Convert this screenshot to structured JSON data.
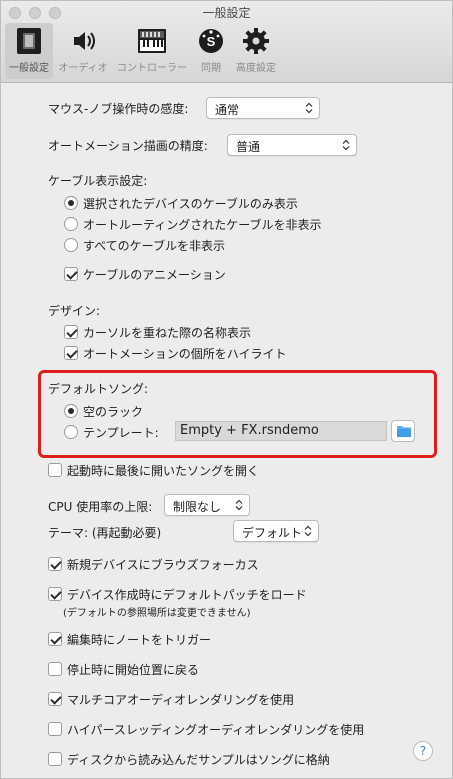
{
  "window": {
    "title": "一般設定"
  },
  "toolbar": {
    "tabs": [
      {
        "label": "一般設定",
        "icon": "device-icon",
        "active": true
      },
      {
        "label": "オーディオ",
        "icon": "speaker-icon",
        "active": false
      },
      {
        "label": "コントローラー",
        "icon": "keyboard-icon",
        "active": false
      },
      {
        "label": "同期",
        "icon": "sync-icon",
        "active": false
      },
      {
        "label": "高度設定",
        "icon": "gear-icon",
        "active": false
      }
    ]
  },
  "mouse_sensitivity": {
    "label": "マウス-ノブ操作時の感度:",
    "value": "通常"
  },
  "automation_precision": {
    "label": "オートメーション描画の精度:",
    "value": "普通"
  },
  "cable_display": {
    "label": "ケーブル表示設定:",
    "options": [
      {
        "label": "選択されたデバイスのケーブルのみ表示",
        "selected": true
      },
      {
        "label": "オートルーティングされたケーブルを非表示",
        "selected": false
      },
      {
        "label": "すべてのケーブルを非表示",
        "selected": false
      }
    ],
    "animation": {
      "label": "ケーブルのアニメーション",
      "checked": true
    }
  },
  "design": {
    "label": "デザイン:",
    "options": [
      {
        "label": "カーソルを重ねた際の名称表示",
        "checked": true
      },
      {
        "label": "オートメーションの個所をハイライト",
        "checked": true
      }
    ]
  },
  "default_song": {
    "label": "デフォルトソング:",
    "empty_rack": {
      "label": "空のラック",
      "selected": true
    },
    "template": {
      "label": "テンプレート:",
      "selected": false
    },
    "template_file": "Empty + FX.rsndemo"
  },
  "open_last_song": {
    "label": "起動時に最後に開いたソングを開く",
    "checked": false
  },
  "cpu_limit": {
    "label": "CPU 使用率の上限:",
    "value": "制限なし"
  },
  "theme": {
    "label": "テーマ: (再起動必要)",
    "value": "デフォルト"
  },
  "options": [
    {
      "label": "新規デバイスにブラウズフォーカス",
      "checked": true
    },
    {
      "label": "デバイス作成時にデフォルトパッチをロード",
      "checked": true,
      "note": "(デフォルトの参照場所は変更できません)"
    },
    {
      "label": "編集時にノートをトリガー",
      "checked": true
    },
    {
      "label": "停止時に開始位置に戻る",
      "checked": false
    },
    {
      "label": "マルチコアオーディオレンダリングを使用",
      "checked": true
    },
    {
      "label": "ハイパースレッディングオーディオレンダリングを使用",
      "checked": false
    },
    {
      "label": "ディスクから読み込んだサンプルはソングに格納",
      "checked": false
    }
  ],
  "help": {
    "label": "?"
  }
}
